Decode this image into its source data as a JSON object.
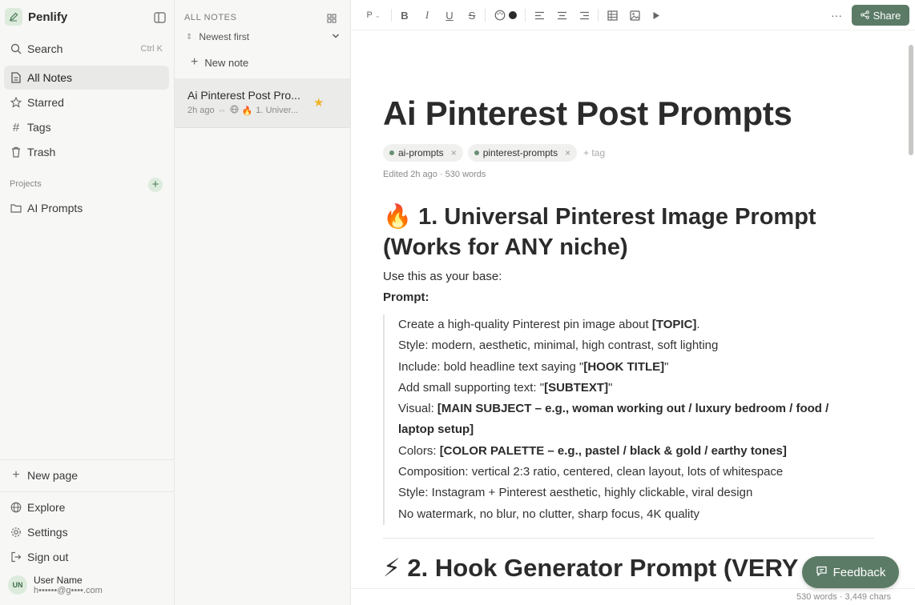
{
  "app": {
    "name": "Penlify"
  },
  "sidebar": {
    "search": {
      "label": "Search",
      "shortcut": "Ctrl K"
    },
    "nav": [
      {
        "label": "All Notes",
        "icon": "file-icon",
        "active": true
      },
      {
        "label": "Starred",
        "icon": "star-icon"
      },
      {
        "label": "Tags",
        "icon": "hash-icon"
      },
      {
        "label": "Trash",
        "icon": "trash-icon"
      }
    ],
    "projects_label": "Projects",
    "projects": [
      {
        "label": "AI Prompts",
        "icon": "folder-icon"
      }
    ],
    "new_page": "New page",
    "footer": [
      {
        "label": "Explore",
        "icon": "globe-icon"
      },
      {
        "label": "Settings",
        "icon": "gear-icon"
      },
      {
        "label": "Sign out",
        "icon": "sign-out-icon"
      }
    ],
    "user": {
      "initials": "UN",
      "name": "User Name",
      "email": "h••••••@g••••.com"
    }
  },
  "notes_list": {
    "title": "ALL NOTES",
    "sort": "Newest first",
    "new_note": "New note",
    "items": [
      {
        "title": "Ai Pinterest Post Pro...",
        "time": "2h ago",
        "preview": "1. Univer...",
        "starred": true
      }
    ]
  },
  "toolbar": {
    "paragraph": "P",
    "share": "Share"
  },
  "document": {
    "title": "Ai Pinterest Post Prompts",
    "tags": [
      "ai-prompts",
      "pinterest-prompts"
    ],
    "add_tag": "+ tag",
    "edited": "Edited 2h ago · 530 words",
    "section1": {
      "emoji": "🔥",
      "heading": "1. Universal Pinterest Image Prompt (Works for ANY niche)"
    },
    "intro": "Use this as your base:",
    "prompt_label": "Prompt:",
    "quote_lines": [
      {
        "text": "Create a high-quality Pinterest pin image about ",
        "bold": "[TOPIC]",
        "after": "."
      },
      {
        "text": "Style: modern, aesthetic, minimal, high contrast, soft lighting",
        "bold": "",
        "after": ""
      },
      {
        "text": "Include: bold headline text saying \"",
        "bold": "[HOOK TITLE]",
        "after": "\""
      },
      {
        "text": "Add small supporting text: \"",
        "bold": "[SUBTEXT]",
        "after": "\""
      },
      {
        "text": "Visual: ",
        "bold": "[MAIN SUBJECT – e.g., woman working out / luxury bedroom / food / laptop setup]",
        "after": ""
      },
      {
        "text": "Colors: ",
        "bold": "[COLOR PALETTE – e.g., pastel / black & gold / earthy tones]",
        "after": ""
      },
      {
        "text": "Composition: vertical 2:3 ratio, centered, clean layout, lots of whitespace",
        "bold": "",
        "after": ""
      },
      {
        "text": "Style: Instagram + Pinterest aesthetic, highly clickable, viral design",
        "bold": "",
        "after": ""
      },
      {
        "text": "No watermark, no blur, no clutter, sharp focus, 4K quality",
        "bold": "",
        "after": ""
      }
    ],
    "section2": {
      "emoji": "⚡",
      "heading": "2. Hook Generator Prompt (VERY"
    }
  },
  "feedback": "Feedback",
  "status": "530 words · 3,449 chars",
  "colors": {
    "accent": "#5b7b66",
    "star": "#f0b429"
  }
}
